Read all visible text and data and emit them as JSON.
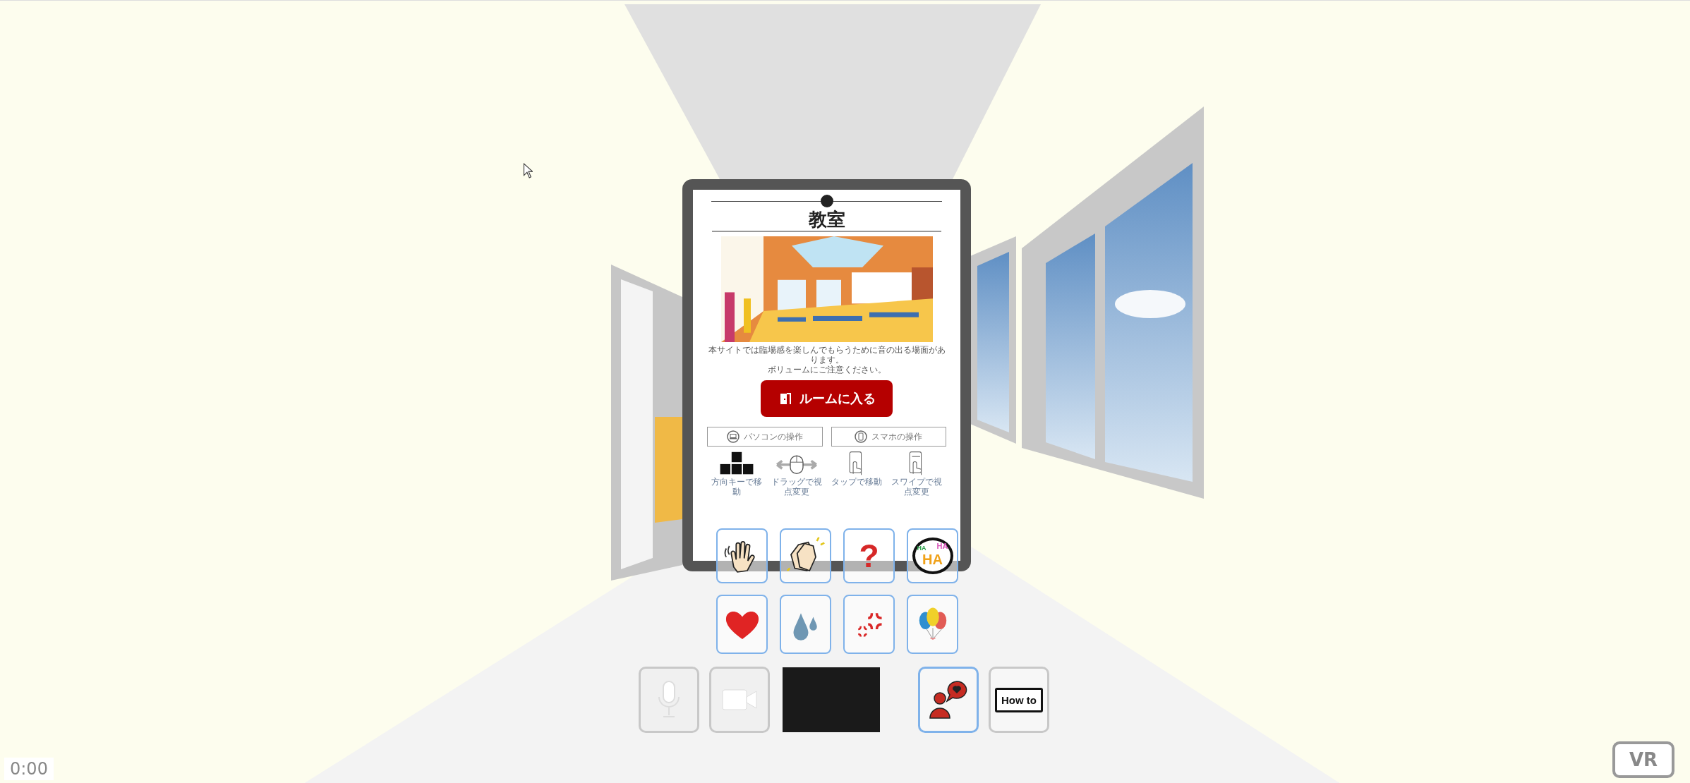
{
  "panel": {
    "title": "教室",
    "image": {
      "kind": "picture"
    },
    "notice": [
      "本サイトでは臨場感を楽しんでもらうために音の出る場面があります。",
      "ボリュームにご注意ください。"
    ],
    "enter_button": "ルームに入る",
    "guide_tabs": [
      {
        "kind": "pc",
        "label": "パソコンの操作"
      },
      {
        "kind": "phone",
        "label": "スマホの操作"
      }
    ],
    "controls": [
      {
        "kind": "keys",
        "caption": "方向キーで移動"
      },
      {
        "kind": "mouse",
        "caption": "ドラッグで視点変更"
      },
      {
        "kind": "tap",
        "caption": "タップで移動"
      },
      {
        "kind": "swipe",
        "caption": "スワイプで視点変更"
      }
    ]
  },
  "reactions": [
    {
      "kind": "wave"
    },
    {
      "kind": "clap"
    },
    {
      "kind": "question",
      "symbol": "?"
    },
    {
      "kind": "laugh",
      "texts": [
        "HA",
        "HA",
        "HA"
      ]
    },
    {
      "kind": "heart"
    },
    {
      "kind": "sweat"
    },
    {
      "kind": "anger"
    },
    {
      "kind": "balloons"
    }
  ],
  "toolbar": [
    {
      "kind": "mic",
      "disabled": true,
      "highlighted": false
    },
    {
      "kind": "camera",
      "disabled": true,
      "highlighted": false
    },
    {
      "kind": "video"
    },
    {
      "kind": "chat",
      "disabled": false,
      "highlighted": true
    },
    {
      "kind": "howto",
      "label": "How to",
      "disabled": false,
      "highlighted": false
    }
  ],
  "timer": "0:00",
  "vr_button": "VR"
}
